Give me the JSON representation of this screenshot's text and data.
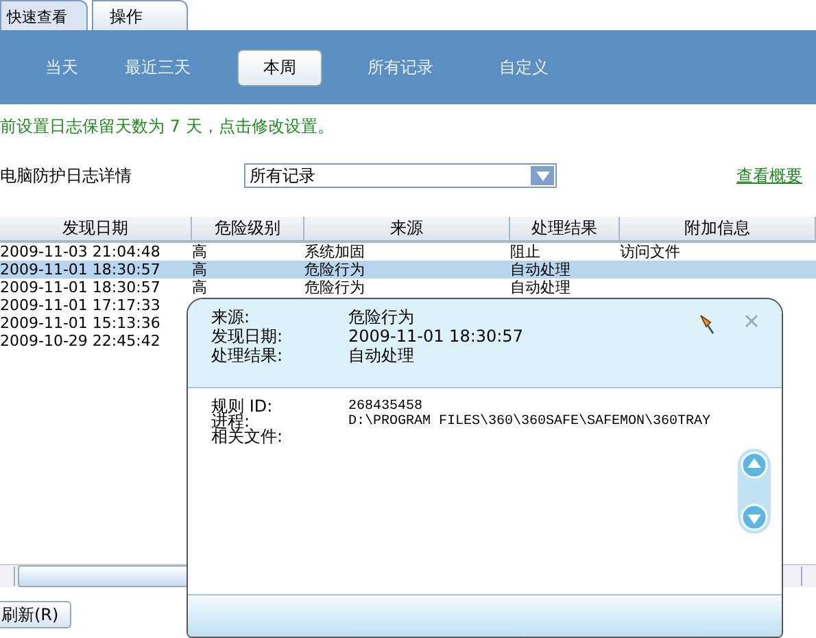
{
  "tabs": [
    {
      "label": "快速查看",
      "selected": true
    },
    {
      "label": "操作",
      "selected": false
    }
  ],
  "filters": [
    {
      "label": "当天",
      "selected": false
    },
    {
      "label": "最近三天",
      "selected": false
    },
    {
      "label": "本周",
      "selected": true
    },
    {
      "label": "所有记录",
      "selected": false
    },
    {
      "label": "自定义",
      "selected": false
    }
  ],
  "notice": "前设置日志保留天数为 7 天，点击修改设置。",
  "section_title": "电脑防护日志详情",
  "dropdown": {
    "value": "所有记录"
  },
  "summary_link": "查看概要",
  "table": {
    "columns": [
      "发现日期",
      "危险级别",
      "来源",
      "处理结果",
      "附加信息"
    ],
    "rows": [
      {
        "cells": [
          "2009-11-03 21:04:48",
          "高",
          "系统加固",
          "阻止",
          "访问文件"
        ],
        "selected": false
      },
      {
        "cells": [
          "2009-11-01 18:30:57",
          "高",
          "危险行为",
          "自动处理"
        ],
        "selected": true
      },
      {
        "cells": [
          "2009-11-01 18:30:57",
          "高",
          "危险行为",
          "自动处理"
        ],
        "selected": false
      },
      {
        "cells": [
          "2009-11-01 17:17:33"
        ],
        "selected": false
      },
      {
        "cells": [
          "2009-11-01 15:13:36"
        ],
        "selected": false
      },
      {
        "cells": [
          "2009-10-29 22:45:42"
        ],
        "selected": false
      }
    ]
  },
  "refresh_button": "刷新(R)",
  "popup": {
    "summary": [
      {
        "label": "来源:",
        "value": "危险行为"
      },
      {
        "label": "发现日期:",
        "value": "2009-11-01 18:30:57"
      },
      {
        "label": "处理结果:",
        "value": "自动处理"
      }
    ],
    "details": [
      {
        "label": "规则 ID:",
        "value": "268435458"
      },
      {
        "label": "进程:",
        "value": "D:\\PROGRAM FILES\\360\\360SAFE\\SAFEMON\\360TRAY"
      },
      {
        "label": "相关文件:"
      }
    ]
  }
}
